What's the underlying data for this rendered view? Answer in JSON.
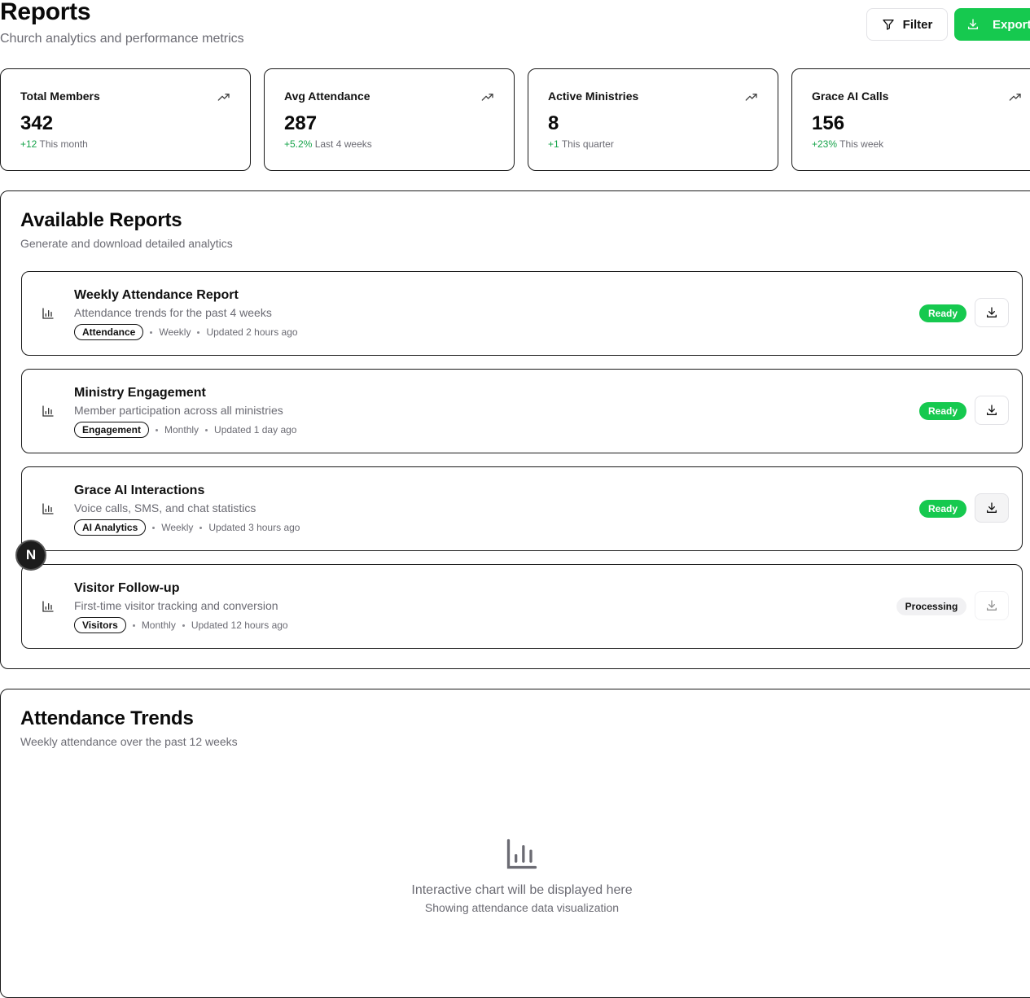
{
  "header": {
    "title": "Reports",
    "subtitle": "Church analytics and performance metrics",
    "filter_label": "Filter",
    "export_label": "Export"
  },
  "stats": [
    {
      "label": "Total Members",
      "value": "342",
      "delta": "+12",
      "period": "This month"
    },
    {
      "label": "Avg Attendance",
      "value": "287",
      "delta": "+5.2%",
      "period": "Last 4 weeks"
    },
    {
      "label": "Active Ministries",
      "value": "8",
      "delta": "+1",
      "period": "This quarter"
    },
    {
      "label": "Grace AI Calls",
      "value": "156",
      "delta": "+23%",
      "period": "This week"
    }
  ],
  "reports_section": {
    "title": "Available Reports",
    "subtitle": "Generate and download detailed analytics",
    "items": [
      {
        "title": "Weekly Attendance Report",
        "description": "Attendance trends for the past 4 weeks",
        "tag": "Attendance",
        "frequency": "Weekly",
        "updated": "Updated 2 hours ago",
        "status": "Ready"
      },
      {
        "title": "Ministry Engagement",
        "description": "Member participation across all ministries",
        "tag": "Engagement",
        "frequency": "Monthly",
        "updated": "Updated 1 day ago",
        "status": "Ready"
      },
      {
        "title": "Grace AI Interactions",
        "description": "Voice calls, SMS, and chat statistics",
        "tag": "AI Analytics",
        "frequency": "Weekly",
        "updated": "Updated 3 hours ago",
        "status": "Ready"
      },
      {
        "title": "Visitor Follow-up",
        "description": "First-time visitor tracking and conversion",
        "tag": "Visitors",
        "frequency": "Monthly",
        "updated": "Updated 12 hours ago",
        "status": "Processing"
      }
    ]
  },
  "trends_section": {
    "title": "Attendance Trends",
    "subtitle": "Weekly attendance over the past 12 weeks",
    "placeholder_main": "Interactive chart will be displayed here",
    "placeholder_sub": "Showing attendance data visualization"
  },
  "avatar_letter": "N",
  "colors": {
    "accent": "#16c94f",
    "positive": "#16a34a",
    "muted": "#6b6b73"
  }
}
